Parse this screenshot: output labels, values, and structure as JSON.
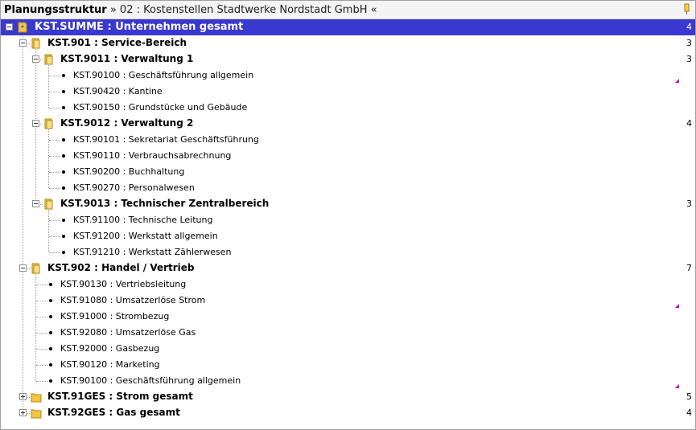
{
  "window": {
    "title_bold": "Planungsstruktur",
    "title_rest": " » 02 : Kostenstellen Stadtwerke Nordstadt GmbH «"
  },
  "tree": {
    "rows": [
      {
        "label": "KST.SUMME : Unternehmen gesamt",
        "count": "4"
      },
      {
        "label": "KST.901 : Service-Bereich",
        "count": "3"
      },
      {
        "label": "KST.9011 : Verwaltung 1",
        "count": "3"
      },
      {
        "label": "KST.90100 : Geschäftsführung allgemein"
      },
      {
        "label": "KST.90420 : Kantine"
      },
      {
        "label": "KST.90150 : Grundstücke und Gebäude"
      },
      {
        "label": "KST.9012 : Verwaltung 2",
        "count": "4"
      },
      {
        "label": "KST.90101 : Sekretariat Geschäftsführung"
      },
      {
        "label": "KST.90110 : Verbrauchsabrechnung"
      },
      {
        "label": "KST.90200 : Buchhaltung"
      },
      {
        "label": "KST.90270 : Personalwesen"
      },
      {
        "label": "KST.9013 : Technischer Zentralbereich",
        "count": "3"
      },
      {
        "label": "KST.91100 : Technische Leitung"
      },
      {
        "label": "KST.91200 : Werkstatt allgemein"
      },
      {
        "label": "KST.91210 : Werkstatt Zählerwesen"
      },
      {
        "label": "KST.902 : Handel / Vertrieb",
        "count": "7"
      },
      {
        "label": "KST.90130 : Vertriebsleitung"
      },
      {
        "label": "KST.91080 : Umsatzerlöse Strom"
      },
      {
        "label": "KST.91000 : Strombezug"
      },
      {
        "label": "KST.92080 : Umsatzerlöse Gas"
      },
      {
        "label": "KST.92000 : Gasbezug"
      },
      {
        "label": "KST.90120 : Marketing"
      },
      {
        "label": "KST.90100 : Geschäftsführung allgemein"
      },
      {
        "label": "KST.91GES : Strom gesamt",
        "count": "5"
      },
      {
        "label": "KST.92GES : Gas gesamt",
        "count": "4"
      }
    ]
  },
  "colors": {
    "selection": "#3a39cf",
    "folder": "#f4c542",
    "marker": "#c000c0"
  }
}
